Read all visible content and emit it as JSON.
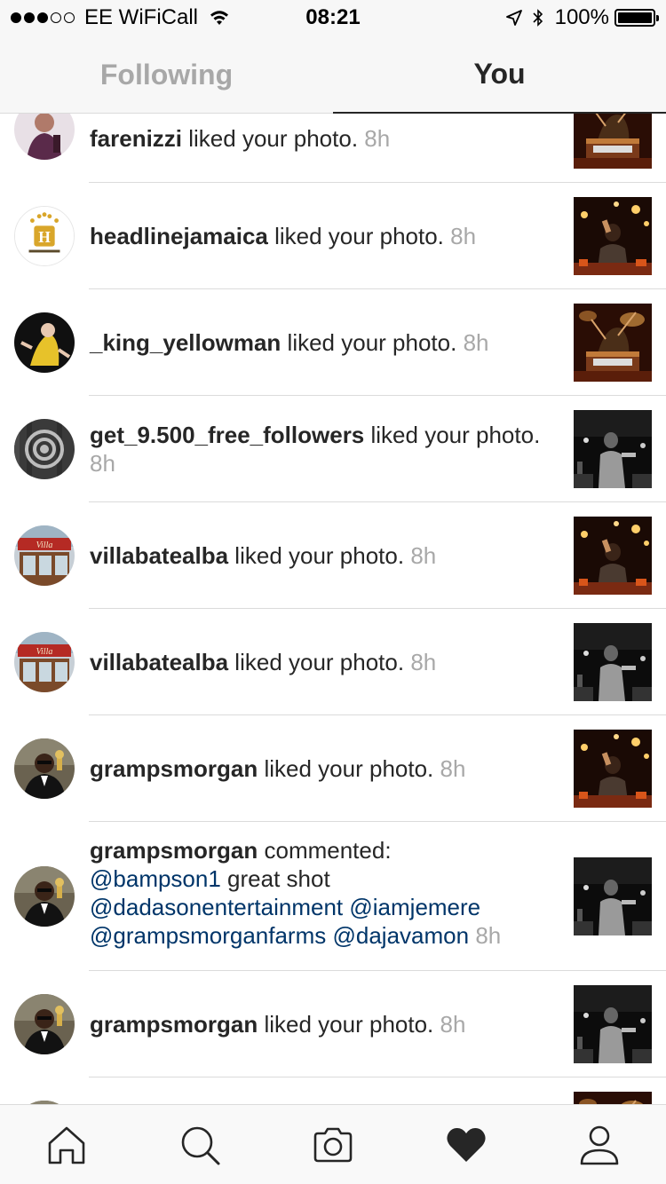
{
  "status_bar": {
    "carrier": "EE WiFiCall",
    "time": "08:21",
    "battery": "100%",
    "signal_bars": 3,
    "signal_total": 5
  },
  "tabs": [
    {
      "label": "Following",
      "active": false
    },
    {
      "label": "You",
      "active": true
    }
  ],
  "activity": [
    {
      "user": "farenizzi",
      "action": " liked your photo.",
      "time": "8h"
    },
    {
      "user": "headlinejamaica",
      "action": " liked your photo.",
      "time": "8h"
    },
    {
      "user": "_king_yellowman",
      "action": " liked your photo.",
      "time": "8h"
    },
    {
      "user": "get_9.500_free_followers",
      "action": " liked your photo.",
      "time": "8h"
    },
    {
      "user": "villabatealba",
      "action": " liked your photo.",
      "time": "8h"
    },
    {
      "user": "villabatealba",
      "action": " liked your photo.",
      "time": "8h"
    },
    {
      "user": "grampsmorgan",
      "action": " liked your photo.",
      "time": "8h"
    },
    {
      "user": "grampsmorgan",
      "action": " commented:",
      "mention1": "@bampson1",
      "comment": " great shot",
      "mention2": "@dadasonentertainment",
      "mention3": "@iamjemere",
      "mention4": "@grampsmorganfarms",
      "mention5": "@dajavamon",
      "time": "8h"
    },
    {
      "user": "grampsmorgan",
      "action": " liked your photo.",
      "time": "8h"
    }
  ],
  "nav": [
    {
      "name": "home-icon"
    },
    {
      "name": "search-icon"
    },
    {
      "name": "camera-icon"
    },
    {
      "name": "heart-icon",
      "active": true
    },
    {
      "name": "profile-icon"
    }
  ],
  "colors": {
    "username": "#262626",
    "timestamp": "#a8a8a8",
    "mention": "#003569",
    "divider": "#dbdbdb"
  }
}
